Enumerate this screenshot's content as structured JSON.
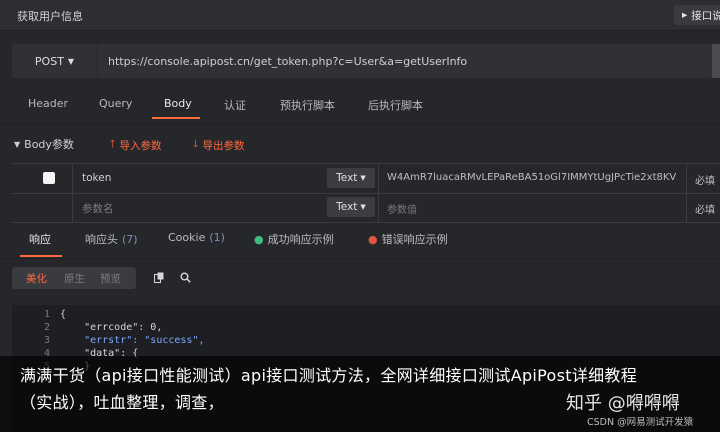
{
  "app": {
    "title": "获取用户信息",
    "right_button": "接口说"
  },
  "request": {
    "method": "POST",
    "url": "https://console.apipost.cn/get_token.php?c=User&a=getUserInfo"
  },
  "tabs": [
    "Header",
    "Query",
    "Body",
    "认证",
    "预执行脚本",
    "后执行脚本"
  ],
  "active_tab": "Body",
  "body": {
    "section_label": "Body参数",
    "import_label": "导入参数",
    "export_label": "导出参数",
    "rows": [
      {
        "key": "token",
        "type": "Text",
        "value": "W4AmR7luacaRMvLEPaReBA51oGl7IMMYtUgJPcTie2xt8KV",
        "required": "必填"
      },
      {
        "key_placeholder": "参数名",
        "type": "Text",
        "value_placeholder": "参数值",
        "required": "必填"
      }
    ]
  },
  "response_tabs": [
    {
      "label": "响应",
      "count": ""
    },
    {
      "label": "响应头",
      "count": "(7)"
    },
    {
      "label": "Cookie",
      "count": "(1)"
    },
    {
      "label": "成功响应示例",
      "count": ""
    },
    {
      "label": "错误响应示例",
      "count": ""
    }
  ],
  "view_modes": [
    "美化",
    "原生",
    "预览"
  ],
  "code": {
    "line_numbers": [
      "1",
      "2",
      "3",
      "4",
      "5"
    ],
    "lines": [
      "{",
      "    \"errcode\": 0,",
      "    \"errstr\": \"success\",",
      "    \"data\": {",
      "    }"
    ]
  },
  "caption": "满满干货（api接口性能测试）api接口测试方法，全网详细接口测试ApiPost详细教程（实战），吐血整理，调查，",
  "watermark": {
    "primary": "知乎 @嘚嘚嘚",
    "secondary": "CSDN @网易测试开发猿"
  },
  "colors": {
    "accent": "#ff6a3d",
    "success": "#3fbf7f",
    "error": "#e0553f"
  }
}
